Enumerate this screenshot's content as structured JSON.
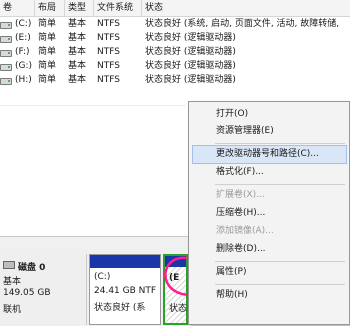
{
  "columns": {
    "volume": "卷",
    "layout": "布局",
    "type": "类型",
    "filesystem": "文件系统",
    "status": "状态"
  },
  "volumes": [
    {
      "name": "(C:)",
      "layout": "简单",
      "type": "基本",
      "fs": "NTFS",
      "status": "状态良好 (系统, 启动, 页面文件, 活动, 故障转储,"
    },
    {
      "name": "(E:)",
      "layout": "简单",
      "type": "基本",
      "fs": "NTFS",
      "status": "状态良好 (逻辑驱动器)"
    },
    {
      "name": "(F:)",
      "layout": "简单",
      "type": "基本",
      "fs": "NTFS",
      "status": "状态良好 (逻辑驱动器)"
    },
    {
      "name": "(G:)",
      "layout": "简单",
      "type": "基本",
      "fs": "NTFS",
      "status": "状态良好 (逻辑驱动器)"
    },
    {
      "name": "(H:)",
      "layout": "简单",
      "type": "基本",
      "fs": "NTFS",
      "status": "状态良好 (逻辑驱动器)"
    }
  ],
  "disk": {
    "name": "磁盘 0",
    "type": "基本",
    "size": "149.05 GB",
    "state": "联机"
  },
  "partitions": [
    {
      "label": "(C:)",
      "size": "24.41 GB NTF",
      "status": "状态良好 (系"
    },
    {
      "label": "(E",
      "size": "",
      "status": "状态"
    }
  ],
  "context_menu": {
    "items": [
      {
        "label": "打开(O)",
        "enabled": true
      },
      {
        "label": "资源管理器(E)",
        "enabled": true
      },
      {
        "label": "更改驱动器号和路径(C)...",
        "enabled": true
      },
      {
        "label": "格式化(F)...",
        "enabled": true
      },
      {
        "label": "扩展卷(X)...",
        "enabled": false
      },
      {
        "label": "压缩卷(H)...",
        "enabled": true
      },
      {
        "label": "添加镜像(A)...",
        "enabled": false
      },
      {
        "label": "删除卷(D)...",
        "enabled": true
      },
      {
        "label": "属性(P)",
        "enabled": true
      },
      {
        "label": "帮助(H)",
        "enabled": true
      }
    ]
  },
  "colors": {
    "partition_bar": "#1b36a8",
    "menu_highlight": "#d8e6f7",
    "annotation": "#ff1e8c"
  }
}
